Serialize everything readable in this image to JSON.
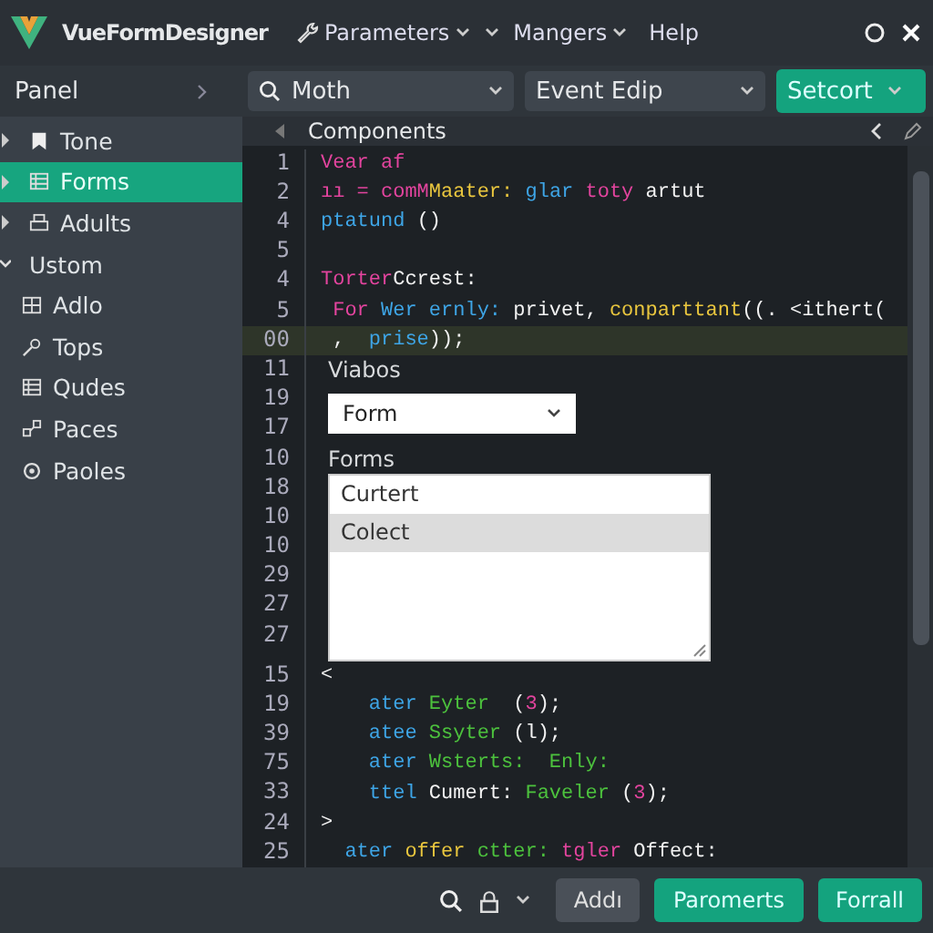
{
  "app": {
    "title": "VueFormDesigner"
  },
  "menu": [
    {
      "kind": "tool",
      "label": "Parameters",
      "dropdown": true
    },
    {
      "kind": "caret"
    },
    {
      "kind": "menu",
      "label": "Mangers",
      "dropdown": true
    },
    {
      "kind": "menu",
      "label": "Help",
      "dropdown": false
    }
  ],
  "toolbar": {
    "panel_title": "Panel",
    "search": {
      "value": "Moth"
    },
    "event_select": {
      "value": "Event Edip"
    },
    "action_button": {
      "label": "Setcort"
    }
  },
  "sidebar": {
    "items": [
      {
        "label": "Tone",
        "selected": false,
        "expanded": false
      },
      {
        "label": "Forms",
        "selected": true,
        "expanded": false
      },
      {
        "label": "Adults",
        "selected": false,
        "expanded": false
      },
      {
        "label": "Ustom",
        "selected": false,
        "expanded": true,
        "children": [
          {
            "label": "Adlo",
            "selected": false
          },
          {
            "label": "Tops",
            "selected": false
          },
          {
            "label": "Qudes",
            "selected": false
          },
          {
            "label": "Paces",
            "selected": false
          },
          {
            "label": "Paoles",
            "selected": false
          }
        ]
      }
    ]
  },
  "editor": {
    "title": "Components",
    "lines": [
      {
        "kind": "code",
        "numbers": [
          "1"
        ],
        "current": false,
        "tokens": [
          {
            "kind": "keyword",
            "text": "Vear af"
          }
        ]
      },
      {
        "kind": "code",
        "numbers": [
          "2"
        ],
        "current": false,
        "tokens": [
          {
            "kind": "keyword",
            "text": "ıı = comM"
          },
          {
            "kind": "func",
            "text": "Maater:"
          },
          {
            "kind": "name",
            "text": " glar"
          },
          {
            "kind": "keyword",
            "text": " toty"
          },
          {
            "kind": "plain",
            "text": " artut"
          }
        ]
      },
      {
        "kind": "code",
        "numbers": [
          "4"
        ],
        "current": false,
        "tokens": [
          {
            "kind": "name",
            "text": "ptatund"
          },
          {
            "kind": "plain",
            "text": " ()"
          }
        ]
      },
      {
        "kind": "code",
        "numbers": [
          "5"
        ],
        "current": false
      },
      {
        "kind": "code",
        "numbers": [
          "4"
        ],
        "current": false,
        "tokens": [
          {
            "kind": "keyword",
            "text": "Torter"
          },
          {
            "kind": "plain",
            "text": "Ccrest:"
          }
        ]
      },
      {
        "kind": "code",
        "numbers": [
          "5"
        ],
        "current": false,
        "tokens": [
          {
            "kind": "keyword",
            "text": " For"
          },
          {
            "kind": "name",
            "text": " Wer ernly:"
          },
          {
            "kind": "plain",
            "text": " privet,"
          },
          {
            "kind": "func",
            "text": " conparttant"
          },
          {
            "kind": "plain",
            "text": "((. <ithert("
          }
        ]
      },
      {
        "kind": "code",
        "numbers": [
          "00"
        ],
        "current": true,
        "tokens": [
          {
            "kind": "plain",
            "text": " ,  "
          },
          {
            "kind": "name",
            "text": "prise"
          },
          {
            "kind": "plain",
            "text": "));"
          }
        ]
      },
      {
        "kind": "label",
        "numbers": [
          "11"
        ],
        "current": false,
        "text": "Viabos"
      },
      {
        "kind": "select",
        "numbers": [
          "19",
          "17"
        ],
        "current": false,
        "value": "Form"
      },
      {
        "kind": "label",
        "numbers": [
          "10"
        ],
        "current": false,
        "text": "Forms"
      },
      {
        "kind": "listbox",
        "numbers": [
          "18",
          "10",
          "10",
          "29",
          "27",
          "27"
        ],
        "current": false,
        "options": [
          {
            "label": "Curtert",
            "selected": false
          },
          {
            "label": "Colect",
            "selected": true
          }
        ]
      },
      {
        "kind": "code",
        "numbers": [
          "15"
        ],
        "current": false,
        "tokens": [
          {
            "kind": "plain",
            "text": "<"
          }
        ]
      },
      {
        "kind": "code",
        "numbers": [
          "19"
        ],
        "current": false,
        "tokens": [
          {
            "kind": "name",
            "text": "    ater"
          },
          {
            "kind": "value",
            "text": " Eyter"
          },
          {
            "kind": "plain",
            "text": "  ("
          },
          {
            "kind": "keyword",
            "text": "3"
          },
          {
            "kind": "plain",
            "text": ");"
          }
        ]
      },
      {
        "kind": "code",
        "numbers": [
          "39"
        ],
        "current": false,
        "tokens": [
          {
            "kind": "name",
            "text": "    atee"
          },
          {
            "kind": "value",
            "text": " Ssyter"
          },
          {
            "kind": "plain",
            "text": " (l);"
          }
        ]
      },
      {
        "kind": "code",
        "numbers": [
          "75"
        ],
        "current": false,
        "tokens": [
          {
            "kind": "name",
            "text": "    ater"
          },
          {
            "kind": "value",
            "text": " Wsterts:  Enly:"
          }
        ]
      },
      {
        "kind": "code",
        "numbers": [
          "33"
        ],
        "current": false,
        "tokens": [
          {
            "kind": "name",
            "text": "    ttel"
          },
          {
            "kind": "plain",
            "text": " Cumert:"
          },
          {
            "kind": "value",
            "text": " Faveler"
          },
          {
            "kind": "plain",
            "text": " ("
          },
          {
            "kind": "keyword",
            "text": "3"
          },
          {
            "kind": "plain",
            "text": ");"
          }
        ]
      },
      {
        "kind": "code",
        "numbers": [
          "24"
        ],
        "current": false,
        "tokens": [
          {
            "kind": "plain",
            "text": ">"
          }
        ]
      },
      {
        "kind": "code",
        "numbers": [
          "25"
        ],
        "current": false,
        "tokens": [
          {
            "kind": "name",
            "text": "  ater"
          },
          {
            "kind": "func",
            "text": " offer"
          },
          {
            "kind": "value",
            "text": " ctter:"
          },
          {
            "kind": "keyword",
            "text": " tgler"
          },
          {
            "kind": "plain",
            "text": " Offect:"
          }
        ]
      }
    ]
  },
  "footer": {
    "buttons": [
      {
        "kind": "secondary",
        "label": "Addı"
      },
      {
        "kind": "primary",
        "label": "Paromerts"
      },
      {
        "kind": "primary",
        "label": "Forrall"
      }
    ]
  }
}
